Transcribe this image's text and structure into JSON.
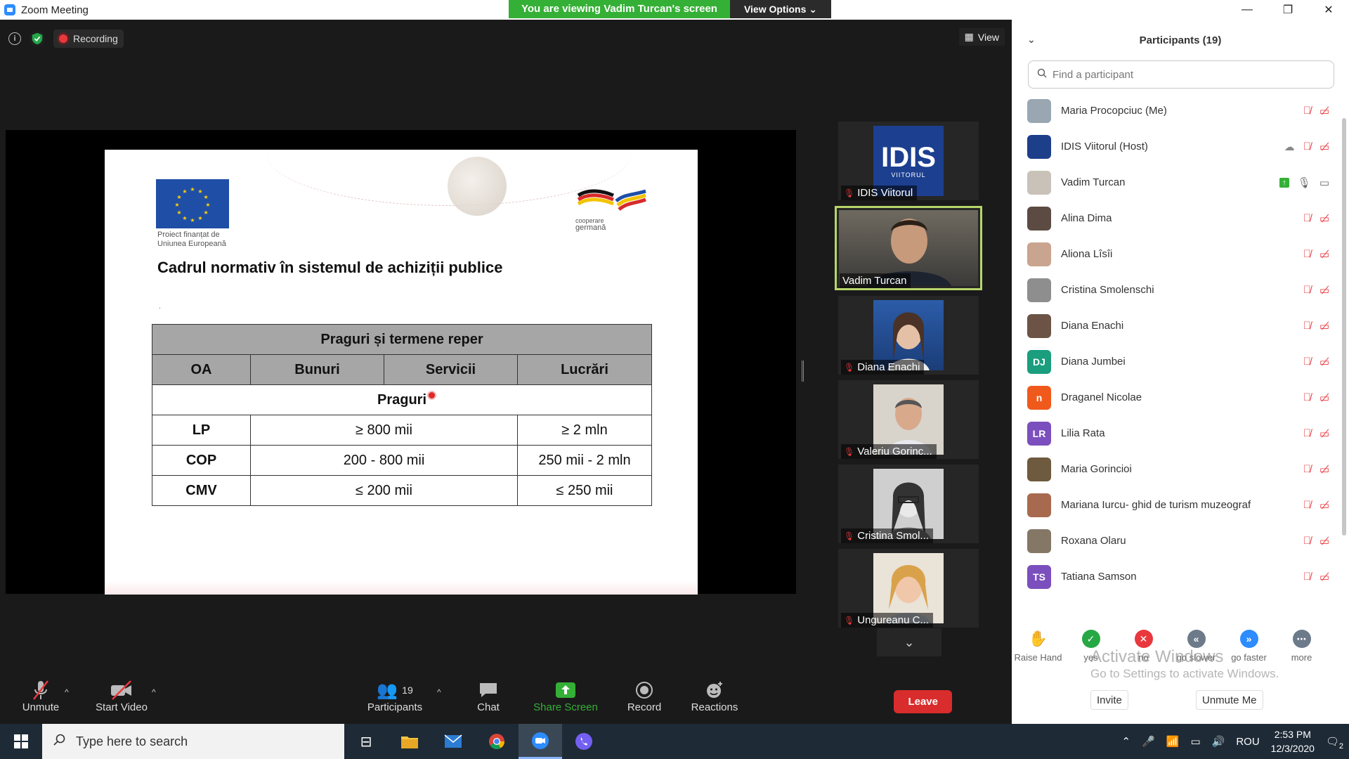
{
  "window": {
    "title": "Zoom Meeting"
  },
  "banner": {
    "viewing": "You are viewing Vadim Turcan's screen",
    "view_options": "View Options"
  },
  "topbar": {
    "recording": "Recording",
    "view": "View"
  },
  "slide": {
    "eu_caption_1": "Proiect finanțat de",
    "eu_caption_2": "Uniunea Europeană",
    "partner_1": "cooperare",
    "partner_2": "germană",
    "title": "Cadrul normativ în sistemul de achiziții publice",
    "dot": ".",
    "table": {
      "caption": "Praguri și termene reper",
      "headers": [
        "OA",
        "Bunuri",
        "Servicii",
        "Lucrări"
      ],
      "section": "Praguri",
      "rows": [
        {
          "oa": "LP",
          "goods_services": "≥ 800 mii",
          "works": "≥ 2 mln"
        },
        {
          "oa": "COP",
          "goods_services": "200 - 800 mii",
          "works": "250 mii - 2 mln"
        },
        {
          "oa": "CMV",
          "goods_services": "≤ 200 mii",
          "works": "≤ 250 mii"
        }
      ]
    }
  },
  "gallery": [
    {
      "name": "IDIS Viitorul",
      "muted": true,
      "logo_text": "IDIS",
      "logo_sub": "VIITORUL"
    },
    {
      "name": "Vadim Turcan",
      "muted": false,
      "active": true
    },
    {
      "name": "Diana Enachi",
      "muted": true
    },
    {
      "name": "Valeriu Gorinc...",
      "muted": true
    },
    {
      "name": "Cristina Smol...",
      "muted": true
    },
    {
      "name": "Ungureanu C...",
      "muted": true
    }
  ],
  "toolbar": {
    "unmute": "Unmute",
    "start_video": "Start Video",
    "participants": "Participants",
    "participants_count": "19",
    "chat": "Chat",
    "share_screen": "Share Screen",
    "record": "Record",
    "reactions": "Reactions",
    "leave": "Leave"
  },
  "panel": {
    "title": "Participants (19)",
    "search_placeholder": "Find a participant",
    "participants": [
      {
        "name": "Maria Procopciuc (Me)",
        "initials": "",
        "color": "#9aa7b3"
      },
      {
        "name": "IDIS Viitorul (Host)",
        "initials": "",
        "color": "#1d3f8a"
      },
      {
        "name": "Vadim Turcan",
        "initials": "",
        "color": "#c9c2b8"
      },
      {
        "name": "Alina Dima",
        "initials": "",
        "color": "#5c4b42"
      },
      {
        "name": "Aliona Lîsîi",
        "initials": "",
        "color": "#c9a48e"
      },
      {
        "name": "Cristina Smolenschi",
        "initials": "",
        "color": "#8e8e8e"
      },
      {
        "name": "Diana Enachi",
        "initials": "",
        "color": "#6b5446"
      },
      {
        "name": "Diana Jumbei",
        "initials": "DJ",
        "color": "#1a9e7d"
      },
      {
        "name": "Draganel Nicolae",
        "initials": "n",
        "color": "#f0591c"
      },
      {
        "name": "Lilia Rata",
        "initials": "LR",
        "color": "#7b4fbd"
      },
      {
        "name": "Maria Gorincioi",
        "initials": "",
        "color": "#6e5a3e"
      },
      {
        "name": "Mariana Iurcu- ghid de turism muzeograf",
        "initials": "",
        "color": "#a86a4f"
      },
      {
        "name": "Roxana Olaru",
        "initials": "",
        "color": "#857766"
      },
      {
        "name": "Tatiana Samson",
        "initials": "TS",
        "color": "#7b4fbd"
      }
    ],
    "reactions": [
      {
        "label": "Raise Hand",
        "color": "#ffffff"
      },
      {
        "label": "yes",
        "color": "#27a844"
      },
      {
        "label": "no",
        "color": "#e8383d"
      },
      {
        "label": "go slower",
        "color": "#6c7a8a"
      },
      {
        "label": "go faster",
        "color": "#2D8CFF"
      },
      {
        "label": "more",
        "color": "#6c7a8a"
      }
    ],
    "watermark_1": "Activate Windows",
    "watermark_2": "Go to Settings to activate Windows.",
    "invite": "Invite",
    "unmute_me": "Unmute Me"
  },
  "taskbar": {
    "search_placeholder": "Type here to search",
    "lang": "ROU",
    "time": "2:53 PM",
    "date": "12/3/2020",
    "notifications": "2"
  }
}
